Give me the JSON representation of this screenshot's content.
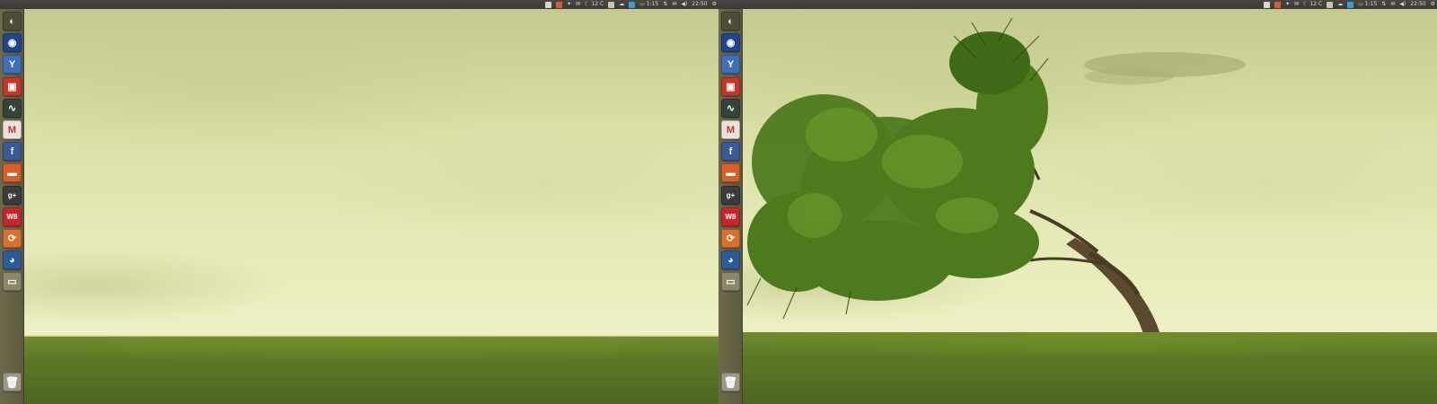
{
  "panel": {
    "temperature": "12 C",
    "battery": "1:15",
    "clock": "22:50"
  },
  "launcher": {
    "items": [
      {
        "name": "dash-home",
        "icon": "ubuntu-logo-icon",
        "color": "#4f4d38",
        "glyph": "◐"
      },
      {
        "name": "web-browser",
        "icon": "globe-icon",
        "color": "#20468f",
        "glyph": "◉"
      },
      {
        "name": "y-ppa-manager",
        "icon": "y-ppa-icon",
        "color": "#3f6fb8",
        "glyph": "Y"
      },
      {
        "name": "software-center",
        "icon": "shopping-bag-icon",
        "color": "#c8332b",
        "glyph": "▣"
      },
      {
        "name": "system-monitor",
        "icon": "monitor-icon",
        "color": "#36433a",
        "glyph": "∿"
      },
      {
        "name": "gmail",
        "icon": "gmail-icon",
        "color": "#e7e2dc",
        "glyph": "M",
        "glyphColor": "#c5332a"
      },
      {
        "name": "facebook",
        "icon": "facebook-icon",
        "color": "#3b5998",
        "glyph": "f"
      },
      {
        "name": "files",
        "icon": "folder-icon",
        "color": "#d9602d",
        "glyph": "▬"
      },
      {
        "name": "google-plus",
        "icon": "google-plus-icon",
        "color": "#3b3b3b",
        "glyph": "g+"
      },
      {
        "name": "w8-app",
        "icon": "w8-icon",
        "color": "#c8262a",
        "glyph": "W8"
      },
      {
        "name": "updater",
        "icon": "refresh-icon",
        "color": "#d9702e",
        "glyph": "⟳"
      },
      {
        "name": "web-browser-2",
        "icon": "globe-cursor-icon",
        "color": "#2d5b9a",
        "glyph": "◕"
      },
      {
        "name": "workspaces",
        "icon": "workspace-switcher-icon",
        "color": "#8a876c",
        "glyph": "▭"
      }
    ],
    "trash": {
      "name": "trash",
      "icon": "trash-icon",
      "color": "#9b9887",
      "glyph": "🗑"
    }
  },
  "colors": {
    "panel": "#3a3935",
    "launcher": "#66644a",
    "sky": "#e6eab8",
    "grass": "#5c7826",
    "tree": "#4d7a1d"
  }
}
